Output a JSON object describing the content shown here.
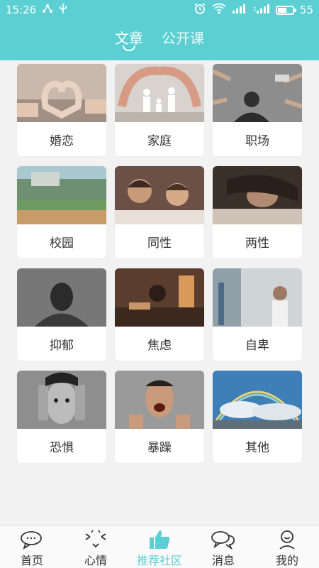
{
  "status_bar": {
    "time": "15:26",
    "battery": "55",
    "battery_level": 0.55
  },
  "header": {
    "tabs": [
      {
        "label": "文章",
        "active": true
      },
      {
        "label": "公开课",
        "active": false
      }
    ]
  },
  "categories": [
    {
      "label": "婚恋",
      "image": "heart-hands-image"
    },
    {
      "label": "家庭",
      "image": "family-hands-image"
    },
    {
      "label": "职场",
      "image": "office-stress-image"
    },
    {
      "label": "校园",
      "image": "campus-image"
    },
    {
      "label": "同性",
      "image": "couple-men-image"
    },
    {
      "label": "两性",
      "image": "couple-bed-image"
    },
    {
      "label": "抑郁",
      "image": "depressed-woman-image"
    },
    {
      "label": "焦虑",
      "image": "anxious-desk-image"
    },
    {
      "label": "自卑",
      "image": "shy-child-image"
    },
    {
      "label": "恐惧",
      "image": "fear-face-image"
    },
    {
      "label": "暴躁",
      "image": "angry-man-image"
    },
    {
      "label": "其他",
      "image": "rainbow-image"
    }
  ],
  "tabbar": {
    "items": [
      {
        "label": "首页",
        "icon": "chat-bubbles-icon",
        "active": false
      },
      {
        "label": "心情",
        "icon": "mood-face-icon",
        "active": false
      },
      {
        "label": "推荐社区",
        "icon": "thumbs-up-icon",
        "active": true
      },
      {
        "label": "消息",
        "icon": "message-bubbles-icon",
        "active": false
      },
      {
        "label": "我的",
        "icon": "user-icon",
        "active": false
      }
    ]
  },
  "colors": {
    "accent": "#5ccfd2"
  }
}
